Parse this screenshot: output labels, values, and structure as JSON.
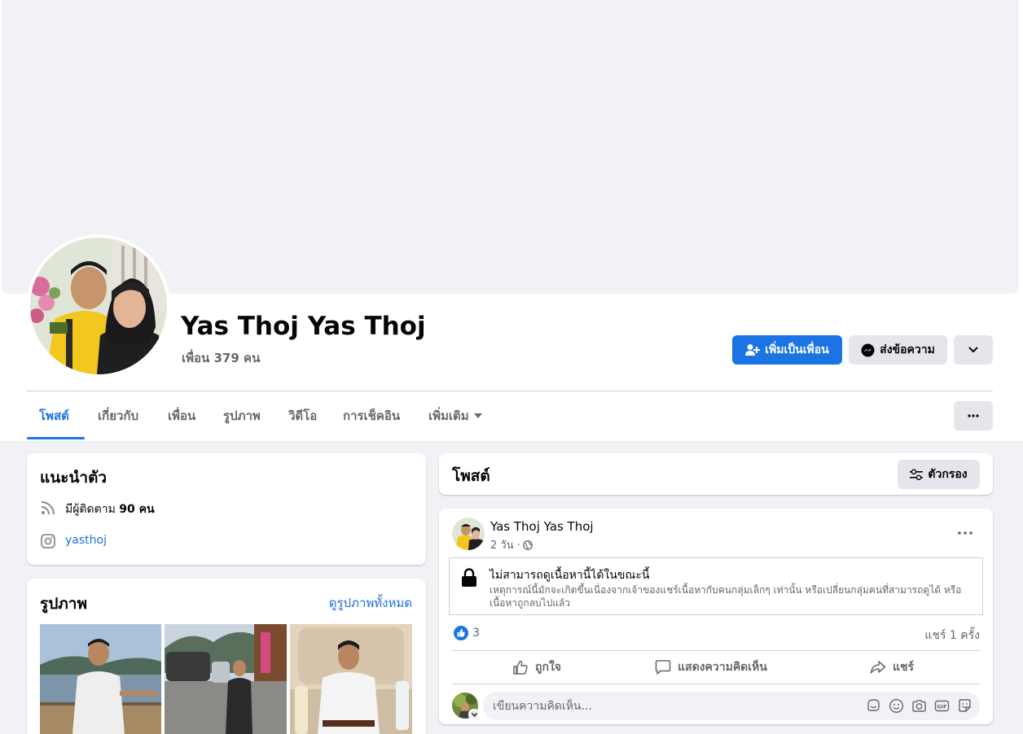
{
  "profile": {
    "name": "Yas Thoj Yas Thoj",
    "friends_count": "เพื่อน 379 คน"
  },
  "actions": {
    "add_friend_label": "เพิ่มเป็นเพื่อน",
    "message_label": "ส่งข้อความ"
  },
  "tabs": [
    {
      "label": "โพสต์",
      "active": true
    },
    {
      "label": "เกี่ยวกับ"
    },
    {
      "label": "เพื่อน"
    },
    {
      "label": "รูปภาพ"
    },
    {
      "label": "วิดีโอ"
    },
    {
      "label": "การเช็คอิน"
    },
    {
      "label": "เพิ่มเติม"
    }
  ],
  "intro": {
    "title": "แนะนำตัว",
    "followers_prefix": "มีผู้ติดตาม",
    "followers_count": "90 คน",
    "instagram": "yasthoj"
  },
  "photos": {
    "title": "รูปภาพ",
    "see_all": "ดูรูปภาพทั้งหมด"
  },
  "posts_header": {
    "title": "โพสต์",
    "filter_label": "ตัวกรอง"
  },
  "post": {
    "author": "Yas Thoj Yas Thoj",
    "time": "2 วัน ·",
    "notice_title": "ไม่สามารถดูเนื้อหานี้ได้ในขณะนี้",
    "notice_desc": "เหตุการณ์นี้มักจะเกิดขึ้นเนื่องจากเจ้าของแชร์เนื้อหากับคนกลุ่มเล็กๆ เท่านั้น หรือเปลี่ยนกลุ่มคนที่สามารถดูได้ หรือเนื้อหาถูกลบไปแล้ว",
    "likes": "3",
    "shares": "แชร์ 1 ครั้ง",
    "like_label": "ถูกใจ",
    "comment_label": "แสดงความคิดเห็น",
    "share_label": "แชร์",
    "comment_placeholder": "เขียนความคิดเห็น..."
  },
  "colors": {
    "accent": "#1b74e4",
    "background": "#f0f2f5",
    "secondary_text": "#65676b"
  }
}
